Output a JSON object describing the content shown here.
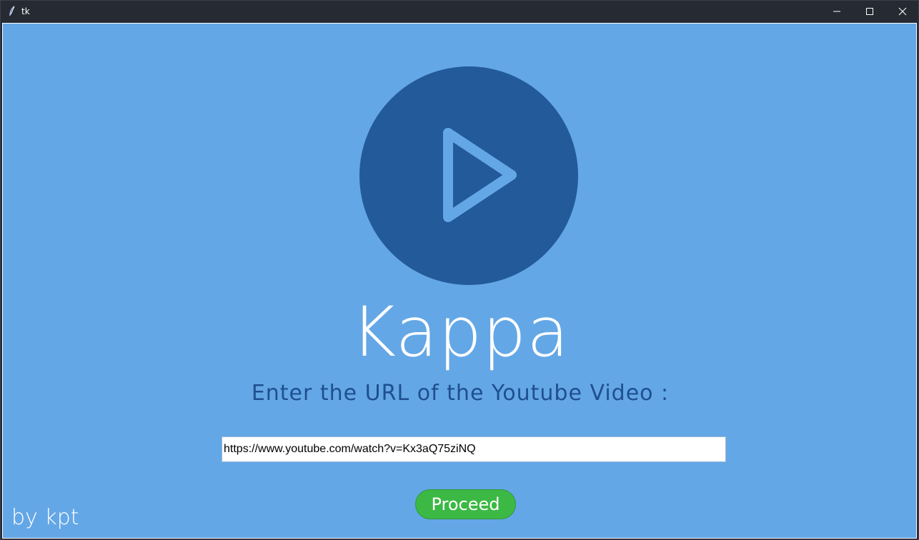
{
  "window": {
    "title": "tk",
    "icon": "feather-icon",
    "controls": {
      "minimize": "minimize-icon",
      "maximize": "maximize-icon",
      "close": "close-icon"
    }
  },
  "app": {
    "logo_icon": "play-icon",
    "name": "Kappa",
    "prompt": "Enter the URL of the Youtube Video :",
    "url_value": "https://www.youtube.com/watch?v=Kx3aQ75ziNQ",
    "proceed_label": "Proceed",
    "credit": "by kpt"
  },
  "colors": {
    "background": "#64a7e6",
    "logo_circle": "#225a9a",
    "prompt_text": "#1f4f8f",
    "button": "#3cb944",
    "titlebar": "#252a33"
  }
}
